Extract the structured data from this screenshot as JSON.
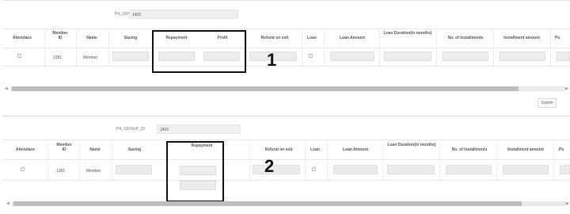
{
  "group": {
    "label": "P4_GROUP_ID",
    "value": "1402"
  },
  "headers": {
    "attendace": "Attendace",
    "member_id": "Member ID",
    "name": "Name",
    "saving": "Saving",
    "repayment": "Repayment",
    "profit": "Profit",
    "refund": "Refund on exit",
    "loan": "Loan",
    "loan_amount": "Loan Amount",
    "loan_duration": "Loan Duration(in months)",
    "installments": "No. of Installments",
    "installment_amount": "Installment amount",
    "last": "Pu"
  },
  "row": {
    "member_id": "1381",
    "name": "Member"
  },
  "submit_label": "Submit",
  "markers": {
    "one": "1",
    "two": "2"
  }
}
